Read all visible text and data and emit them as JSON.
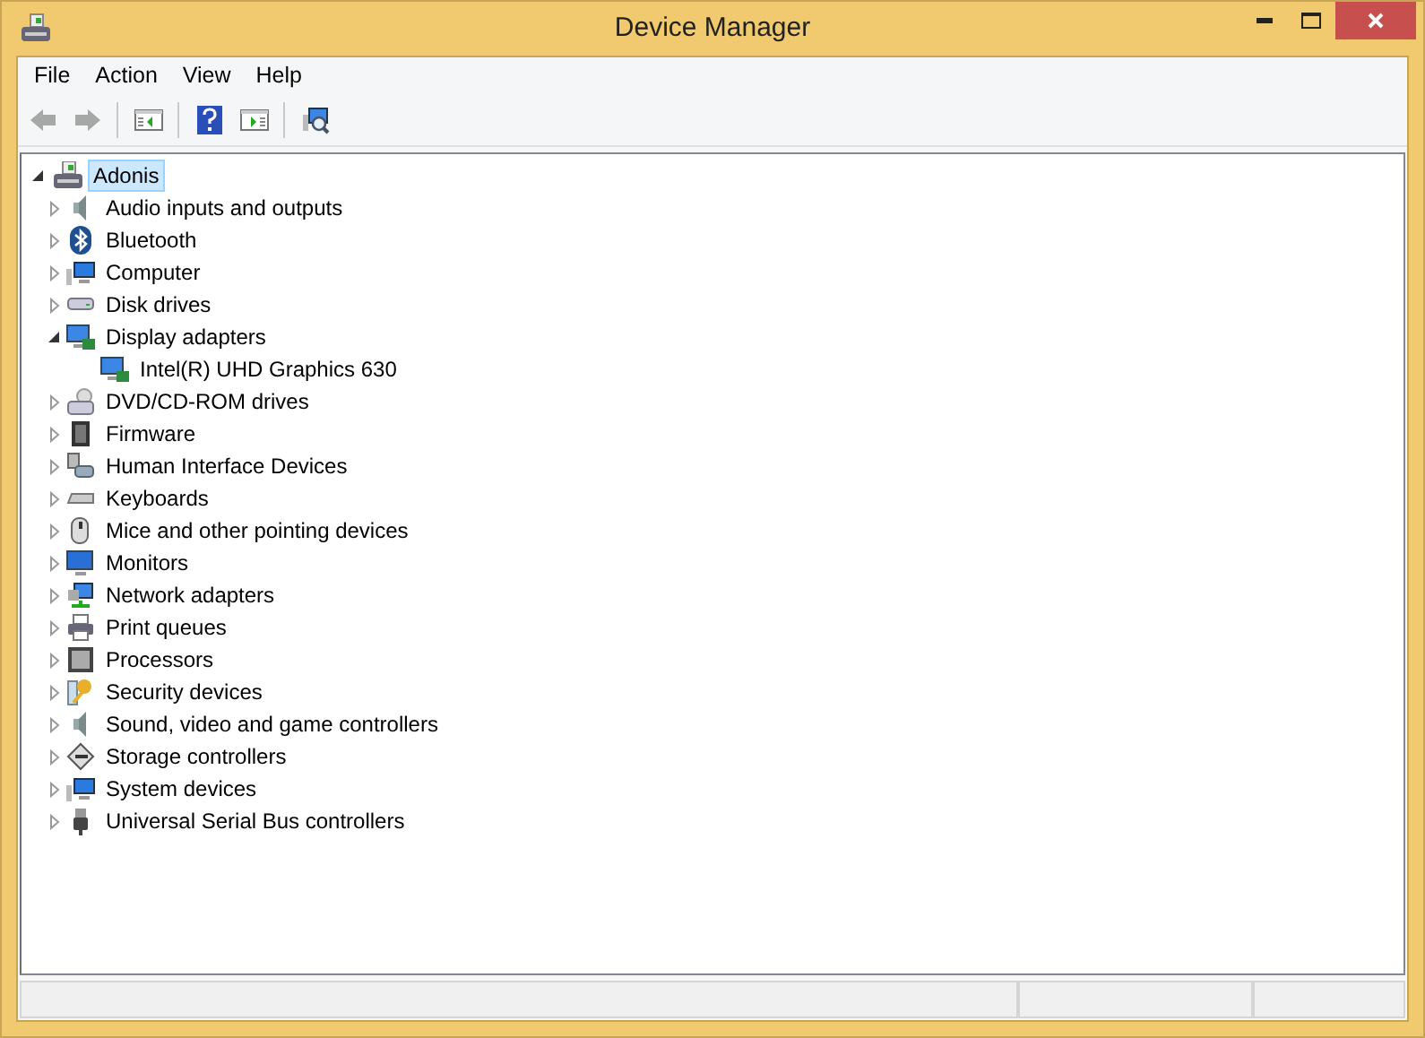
{
  "window": {
    "title": "Device Manager"
  },
  "menu": [
    "File",
    "Action",
    "View",
    "Help"
  ],
  "toolbar": [
    [
      {
        "disabled": true
      },
      {
        "disabled": true
      }
    ],
    [
      {
        "disabled": false
      }
    ],
    [
      {
        "disabled": false
      },
      {
        "disabled": false
      }
    ],
    [
      {
        "disabled": false
      }
    ]
  ],
  "tree": {
    "label": "Adonis",
    "selected": true,
    "expanded": true,
    "children": [
      {
        "label": "Audio inputs and outputs",
        "expanded": false
      },
      {
        "label": "Bluetooth",
        "expanded": false
      },
      {
        "label": "Computer",
        "expanded": false
      },
      {
        "label": "Disk drives",
        "expanded": false
      },
      {
        "label": "Display adapters",
        "expanded": true,
        "children": [
          {
            "label": "Intel(R) UHD Graphics 630"
          }
        ]
      },
      {
        "label": "DVD/CD-ROM drives",
        "expanded": false
      },
      {
        "label": "Firmware",
        "expanded": false
      },
      {
        "label": "Human Interface Devices",
        "expanded": false
      },
      {
        "label": "Keyboards",
        "expanded": false
      },
      {
        "label": "Mice and other pointing devices",
        "expanded": false
      },
      {
        "label": "Monitors",
        "expanded": false
      },
      {
        "label": "Network adapters",
        "expanded": false
      },
      {
        "label": "Print queues",
        "expanded": false
      },
      {
        "label": "Processors",
        "expanded": false
      },
      {
        "label": "Security devices",
        "expanded": false
      },
      {
        "label": "Sound, video and game controllers",
        "expanded": false
      },
      {
        "label": "Storage controllers",
        "expanded": false
      },
      {
        "label": "System devices",
        "expanded": false
      },
      {
        "label": "Universal Serial Bus controllers",
        "expanded": false
      }
    ]
  }
}
